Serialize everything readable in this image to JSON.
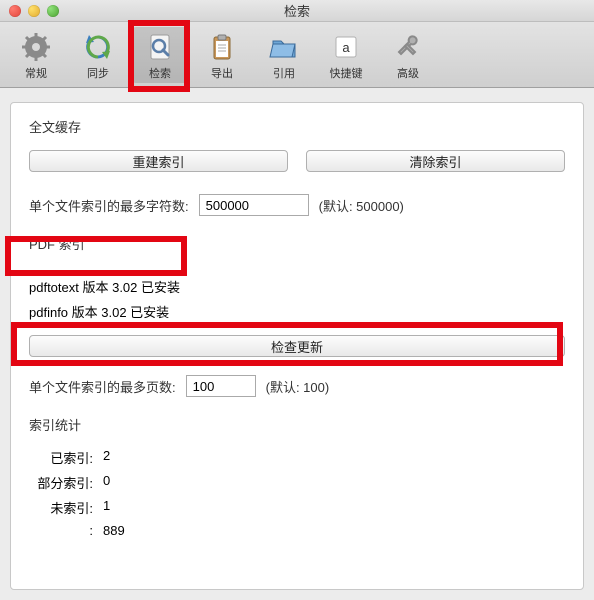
{
  "window": {
    "title": "检索"
  },
  "toolbar": {
    "items": [
      {
        "label": "常规"
      },
      {
        "label": "同步"
      },
      {
        "label": "检索"
      },
      {
        "label": "导出"
      },
      {
        "label": "引用"
      },
      {
        "label": "快捷键"
      },
      {
        "label": "高级"
      }
    ]
  },
  "sections": {
    "fulltext_cache": "全文缓存",
    "pdf_index": "PDF 索引",
    "index_stats": "索引统计"
  },
  "buttons": {
    "rebuild_index": "重建索引",
    "clear_index": "清除索引",
    "check_updates": "检查更新"
  },
  "max_chars": {
    "label": "单个文件索引的最多字符数:",
    "value": "500000",
    "default": "(默认: 500000)"
  },
  "pdf_tools": {
    "pdftotext": "pdftotext 版本 3.02 已安装",
    "pdfinfo": "pdfinfo 版本 3.02 已安装"
  },
  "max_pages": {
    "label": "单个文件索引的最多页数:",
    "value": "100",
    "default": "(默认: 100)"
  },
  "stats": {
    "indexed_label": "已索引:",
    "indexed_value": "2",
    "partial_label": "部分索引:",
    "partial_value": "0",
    "unindexed_label": "未索引:",
    "unindexed_value": "1",
    "more_label": ":",
    "more_value": "889"
  }
}
